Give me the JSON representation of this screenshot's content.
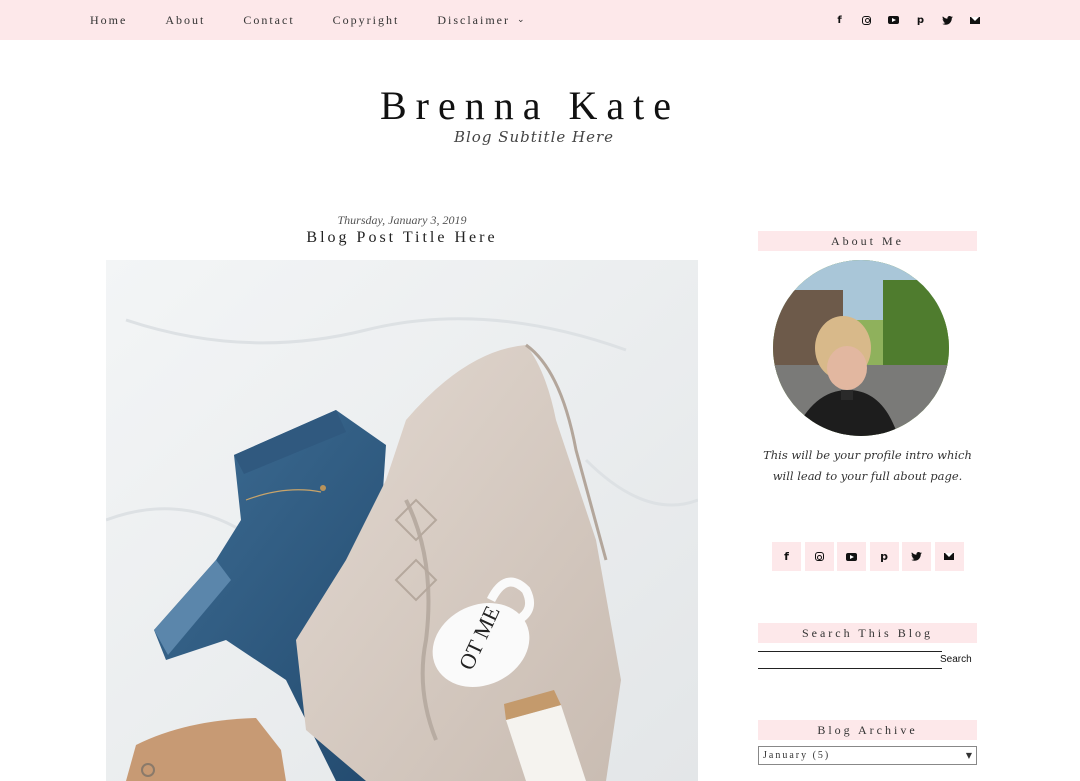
{
  "nav": {
    "items": [
      {
        "label": "Home"
      },
      {
        "label": "About"
      },
      {
        "label": "Contact"
      },
      {
        "label": "Copyright"
      },
      {
        "label": "Disclaimer"
      }
    ]
  },
  "social_icons": [
    "facebook-icon",
    "instagram-icon",
    "youtube-icon",
    "pinterest-icon",
    "twitter-icon",
    "envelope-icon"
  ],
  "header": {
    "title": "Brenna Kate",
    "subtitle": "Blog Subtitle Here"
  },
  "post": {
    "date": "Thursday, January 3, 2019",
    "title": "Blog Post Title Here"
  },
  "sidebar": {
    "about_title": "About Me",
    "profile_intro": "This will be your profile intro which will lead to your full about page.",
    "search_title": "Search This Blog",
    "search_button": "Search",
    "archive_title": "Blog Archive",
    "archive_selected": "January (5)"
  },
  "colors": {
    "accent_pink": "#fde8ea",
    "text_dark": "#222222"
  }
}
